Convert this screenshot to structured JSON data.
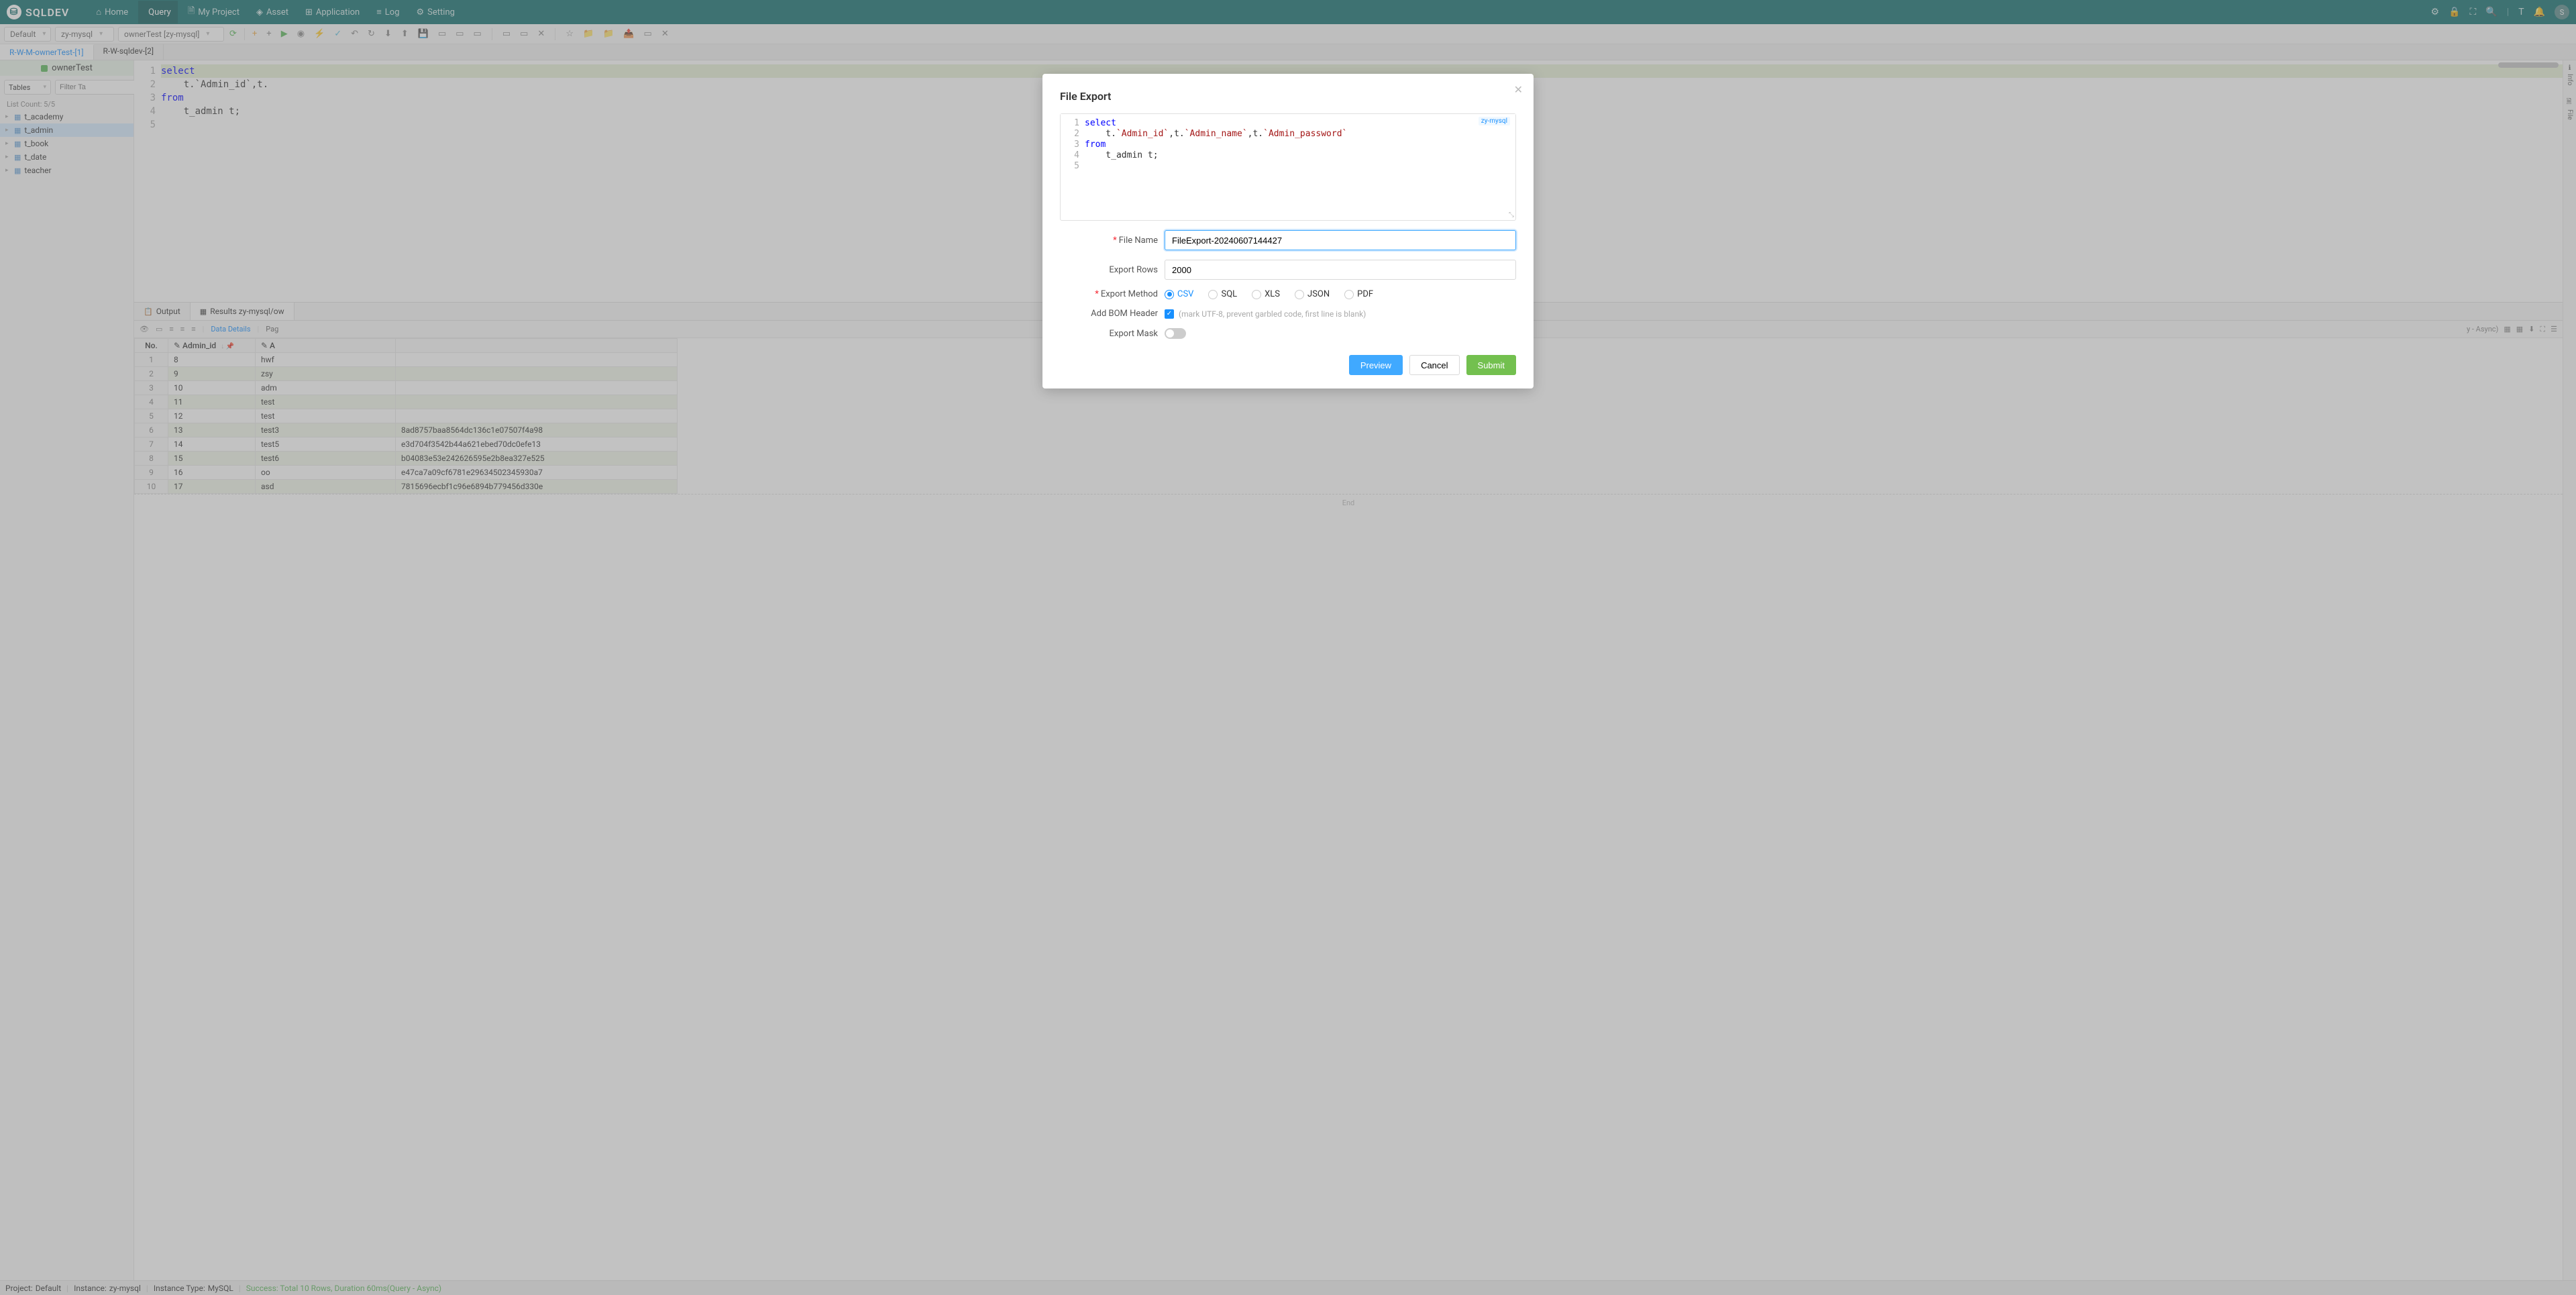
{
  "brand": "SQLDEV",
  "nav": [
    {
      "label": "Home",
      "icon": "⌂"
    },
    {
      "label": "Query",
      "icon": "</>",
      "active": true
    },
    {
      "label": "My Project",
      "icon": "🗎"
    },
    {
      "label": "Asset",
      "icon": "◈"
    },
    {
      "label": "Application",
      "icon": "⊞"
    },
    {
      "label": "Log",
      "icon": "≡"
    },
    {
      "label": "Setting",
      "icon": "⚙"
    }
  ],
  "topbar_icons": [
    "settings-icon",
    "lock-icon",
    "fullscreen-icon",
    "search-icon",
    "divider",
    "format-icon",
    "bell-icon"
  ],
  "avatar_initial": "S",
  "toolbar": {
    "select1": "Default",
    "select2": "zy-mysql",
    "select3": "ownerTest [zy-mysql]"
  },
  "file_tabs": [
    {
      "label": "R-W-M-ownerTest-[1]",
      "active": true
    },
    {
      "label": "R-W-sqldev-[2]",
      "active": false
    }
  ],
  "sidebar": {
    "db_name": "ownerTest",
    "filter_dropdown": "Tables",
    "filter_placeholder": "Filter Ta",
    "list_count": "List Count:  5/5",
    "tables": [
      "t_academy",
      "t_admin",
      "t_book",
      "t_date",
      "teacher"
    ],
    "selected": "t_admin"
  },
  "editor": {
    "lines": [
      {
        "n": 1,
        "txt": "select",
        "cls": "kw-blue hl-line"
      },
      {
        "n": 2,
        "txt": "    t.`Admin_id`,t.",
        "cls": ""
      },
      {
        "n": 3,
        "txt": "from",
        "cls": "kw-blue"
      },
      {
        "n": 4,
        "txt": "    t_admin t;",
        "cls": ""
      },
      {
        "n": 5,
        "txt": "",
        "cls": ""
      }
    ]
  },
  "result_tabs": [
    {
      "label": "Output",
      "icon": "📋",
      "active": false
    },
    {
      "label": "Results zy-mysql/ow",
      "icon": "▦",
      "active": true
    }
  ],
  "result_toolbar": {
    "data_details": "Data Details",
    "page": "Pag",
    "exec_info": "y - Async)"
  },
  "table": {
    "headers": [
      "No.",
      "Admin_id",
      "A"
    ],
    "rows": [
      {
        "no": 1,
        "id": "8",
        "name": "hwf",
        "hash": ""
      },
      {
        "no": 2,
        "id": "9",
        "name": "zsy",
        "hash": ""
      },
      {
        "no": 3,
        "id": "10",
        "name": "adm",
        "hash": ""
      },
      {
        "no": 4,
        "id": "11",
        "name": "test",
        "hash": ""
      },
      {
        "no": 5,
        "id": "12",
        "name": "test",
        "hash": ""
      },
      {
        "no": 6,
        "id": "13",
        "name": "test3",
        "hash": "8ad8757baa8564dc136c1e07507f4a98"
      },
      {
        "no": 7,
        "id": "14",
        "name": "test5",
        "hash": "e3d704f3542b44a621ebed70dc0efe13"
      },
      {
        "no": 8,
        "id": "15",
        "name": "test6",
        "hash": "b04083e53e242626595e2b8ea327e525"
      },
      {
        "no": 9,
        "id": "16",
        "name": "oo",
        "hash": "e47ca7a09cf6781e29634502345930a7"
      },
      {
        "no": 10,
        "id": "17",
        "name": "asd",
        "hash": "7815696ecbf1c96e6894b779456d330e"
      }
    ],
    "end": "End"
  },
  "right_rail": [
    {
      "icon": "ℹ",
      "label": "Info"
    },
    {
      "icon": "🗎",
      "label": "File"
    }
  ],
  "status": {
    "project_lbl": "Project: ",
    "project_val": "Default",
    "instance_lbl": "Instance: ",
    "instance_val": "zy-mysql",
    "type_lbl": "Instance Type: ",
    "type_val": "MySQL",
    "success": "Success:  Total 10 Rows, Duration 60ms(Query - Async)"
  },
  "modal": {
    "title": "File Export",
    "code_lines": [
      {
        "n": 1,
        "segs": [
          {
            "t": "select",
            "c": "kw-blue"
          }
        ]
      },
      {
        "n": 2,
        "segs": [
          {
            "t": "    t.",
            "c": ""
          },
          {
            "t": "`Admin_id`",
            "c": "kw-red"
          },
          {
            "t": ",t.",
            "c": ""
          },
          {
            "t": "`Admin_name`",
            "c": "kw-red"
          },
          {
            "t": ",t.",
            "c": ""
          },
          {
            "t": "`Admin_password`",
            "c": "kw-red"
          }
        ]
      },
      {
        "n": 3,
        "segs": [
          {
            "t": "from",
            "c": "kw-blue"
          }
        ]
      },
      {
        "n": 4,
        "segs": [
          {
            "t": "    t_admin t;",
            "c": ""
          }
        ]
      },
      {
        "n": 5,
        "segs": [
          {
            "t": "",
            "c": ""
          }
        ]
      }
    ],
    "badge": "zy-mysql",
    "file_name_label": "File Name",
    "file_name_value": "FileExport-20240607144427",
    "export_rows_label": "Export Rows",
    "export_rows_value": "2000",
    "export_method_label": "Export Method",
    "methods": [
      "CSV",
      "SQL",
      "XLS",
      "JSON",
      "PDF"
    ],
    "method_selected": "CSV",
    "bom_label": "Add BOM Header",
    "bom_hint": "(mark UTF-8, prevent garbled code, first line is blank)",
    "mask_label": "Export Mask",
    "btn_preview": "Preview",
    "btn_cancel": "Cancel",
    "btn_submit": "Submit"
  }
}
